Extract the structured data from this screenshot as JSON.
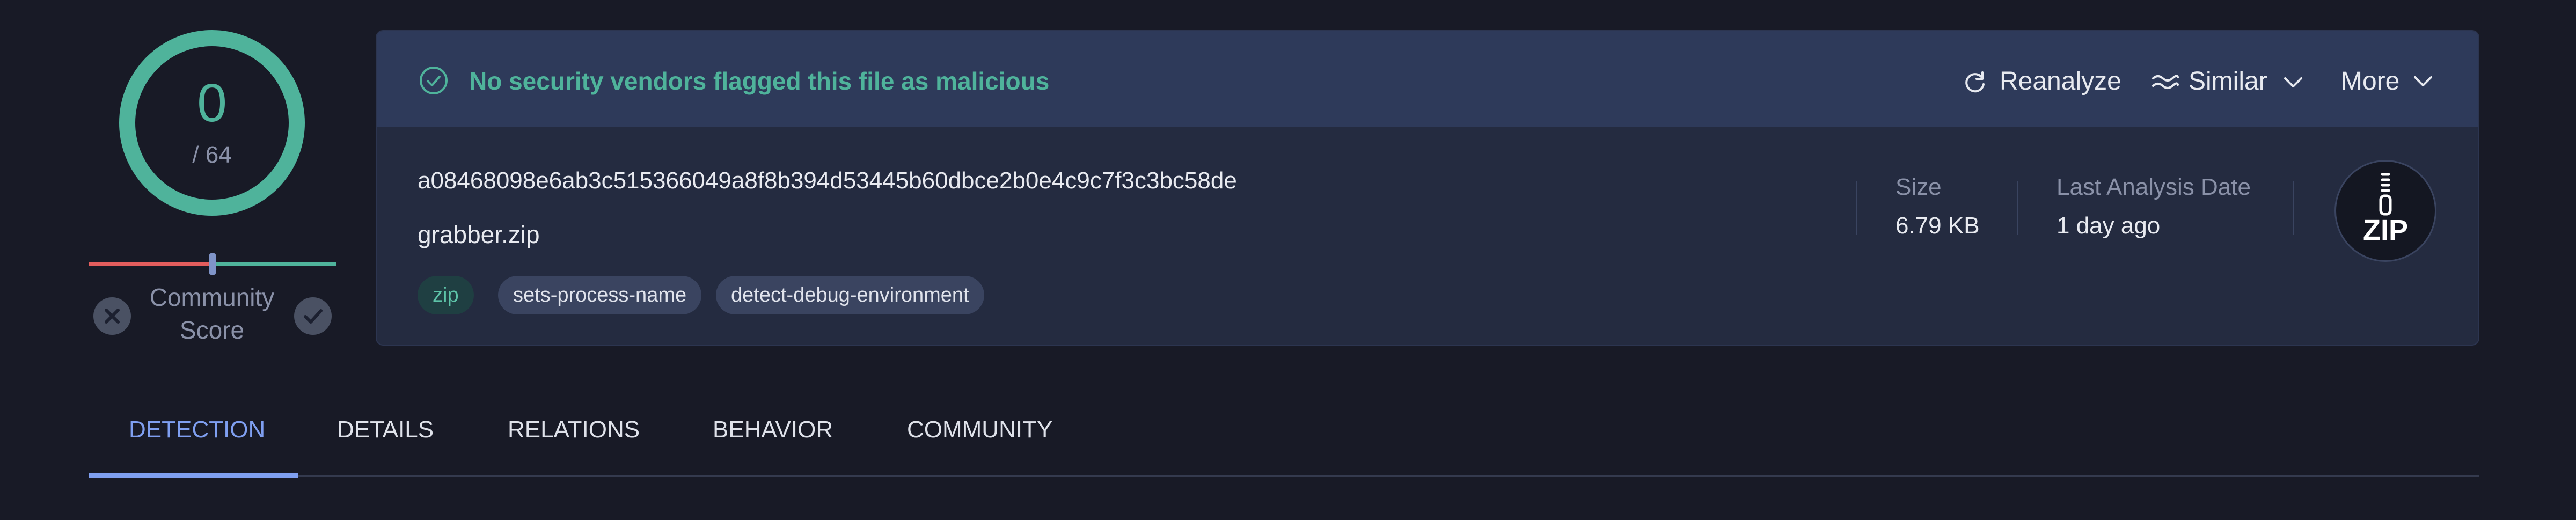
{
  "score": {
    "detections": "0",
    "total": "/ 64",
    "community_label": "Community Score",
    "ring_color": "#4fb39b",
    "negative_color": "#e35d5d",
    "positive_color": "#4fb39b"
  },
  "status": {
    "message": "No security vendors flagged this file as malicious",
    "icon": "check-circle-icon",
    "color": "#4fb39b"
  },
  "actions": {
    "reanalyze": "Reanalyze",
    "similar": "Similar",
    "more": "More"
  },
  "file": {
    "hash": "a08468098e6ab3c515366049a8f8b394d53445b60dbce2b0e4c9c7f3c3bc58de",
    "name": "grabber.zip",
    "tags": [
      "zip",
      "sets-process-name",
      "detect-debug-environment"
    ],
    "type_badge": "ZIP"
  },
  "meta": {
    "size_label": "Size",
    "size_value": "6.79 KB",
    "date_label": "Last Analysis Date",
    "date_value": "1 day ago"
  },
  "tabs": [
    {
      "label": "DETECTION",
      "active": true
    },
    {
      "label": "DETAILS",
      "active": false
    },
    {
      "label": "RELATIONS",
      "active": false
    },
    {
      "label": "BEHAVIOR",
      "active": false
    },
    {
      "label": "COMMUNITY",
      "active": false
    }
  ],
  "colors": {
    "background": "#181a26",
    "card": "#242b40",
    "card_header": "#2e3a5a",
    "accent": "#7f9ff0"
  }
}
